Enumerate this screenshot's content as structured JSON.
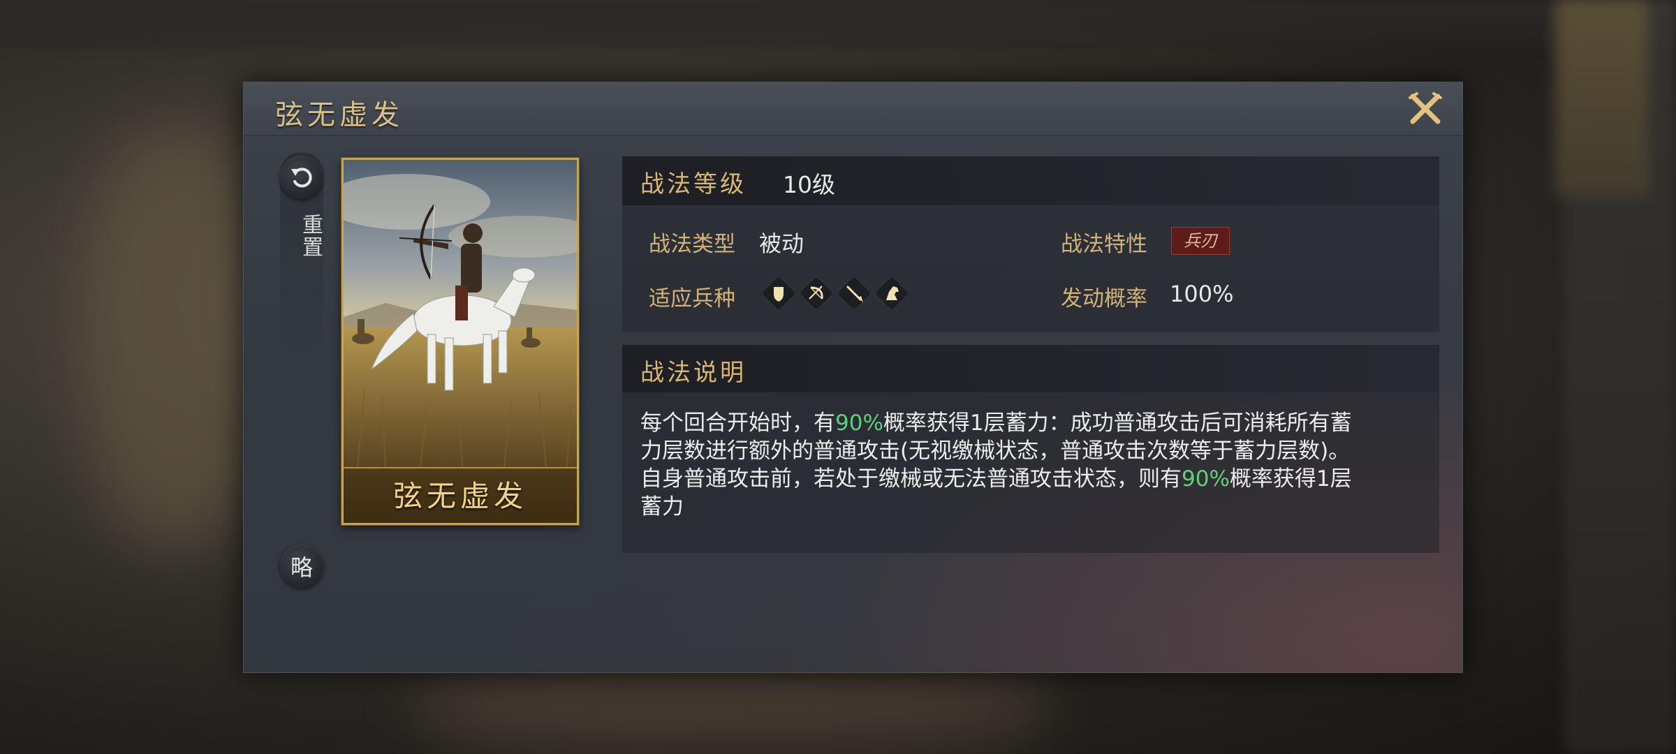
{
  "skill": {
    "name": "弦无虚发",
    "card_name": "弦无虚发"
  },
  "side": {
    "reset_label": "重置",
    "summary_label": "略"
  },
  "level": {
    "label": "战法等级",
    "value": "10级"
  },
  "attributes": {
    "type_label": "战法类型",
    "type_value": "被动",
    "trait_label": "战法特性",
    "trait_value": "兵刃",
    "troops_label": "适应兵种",
    "troops": [
      "shield-icon",
      "bow-icon",
      "spear-icon",
      "horse-icon"
    ],
    "chance_label": "发动概率",
    "chance_value": "100%"
  },
  "description": {
    "label": "战法说明",
    "line1_a": "每个回合开始时，有",
    "line1_pct": "90%",
    "line1_b": "概率获得1层蓄力：成功普通攻击后可消耗所有蓄",
    "line2": "力层数进行额外的普通攻击(无视缴械状态，普通攻击次数等于蓄力层数)。",
    "line3_a": "自身普通攻击前，若处于缴械或无法普通攻击状态，则有",
    "line3_pct": "90%",
    "line3_b": "概率获得1层",
    "line4": "蓄力"
  },
  "colors": {
    "gold": "#d8b676",
    "highlight_green": "#5fcf7a",
    "trait_red": "#5b1c1a"
  }
}
